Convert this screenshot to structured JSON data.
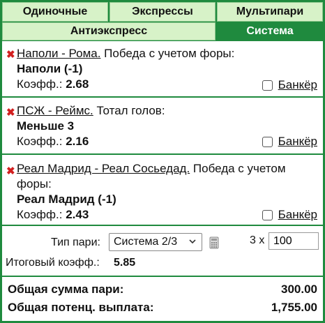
{
  "tabs": {
    "single": "Одиночные",
    "express": "Экспрессы",
    "multi": "Мультипари",
    "antiexpress": "Антиэкспресс",
    "system": "Система"
  },
  "bets": [
    {
      "match": "Наполи - Рома.",
      "market": " Победа с учетом форы:",
      "pick": "Наполи (-1)",
      "coef_label": "Коэфф.: ",
      "coef": "2.68",
      "banker": "Банкёр"
    },
    {
      "match": "ПСЖ - Реймс.",
      "market": " Тотал голов:",
      "pick": "Меньше 3",
      "coef_label": "Коэфф.: ",
      "coef": "2.16",
      "banker": "Банкёр"
    },
    {
      "match": "Реал Мадрид - Реал Сосьедад.",
      "market": " Победа с учетом форы:",
      "pick": "Реал Мадрид (-1)",
      "coef_label": "Коэфф.: ",
      "coef": "2.43",
      "banker": "Банкёр"
    }
  ],
  "settings": {
    "type_label": "Тип пари:",
    "type_value": "Система 2/3",
    "multiplier": "3 x",
    "stake": "100",
    "total_coef_label": "Итоговый коэфф.:",
    "total_coef": "5.85"
  },
  "summary": {
    "total_label": "Общая сумма пари:",
    "total_value": "300.00",
    "payout_label": "Общая потенц. выплата:",
    "payout_value": "1,755.00"
  },
  "colors": {
    "accent": "#1f8a3e",
    "tab_bg": "#d7f2c8",
    "remove": "#d21f1f"
  }
}
